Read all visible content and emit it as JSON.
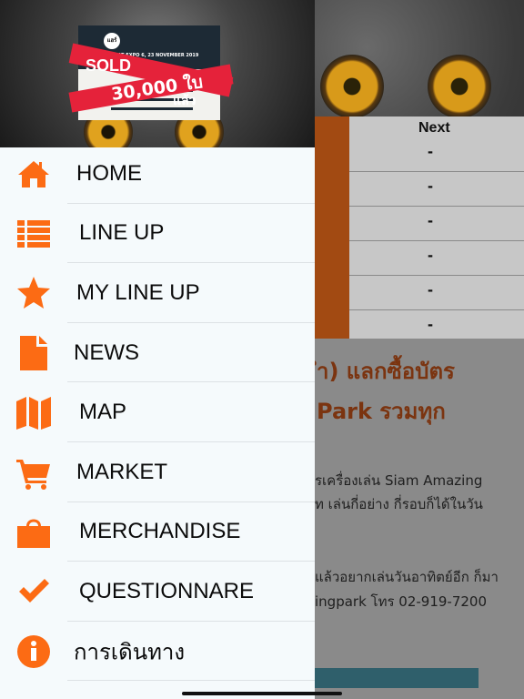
{
  "background": {
    "table": {
      "header": "Next",
      "rows": [
        "-",
        "-",
        "-",
        "-",
        "-",
        "-"
      ]
    },
    "headline_lines": [
      "ำ) แลกซื้อบัตร",
      "Park รวมทุก"
    ],
    "paragraph_lines": [
      "รเครื่องเล่น Siam Amazing",
      "ท เล่นกี่อย่าง กี่รอบก็ได้ในวัน",
      "แล้วอยากเล่นวันอาทิตย์อีก ก็มา",
      "ingpark โทร 02-919-7200"
    ]
  },
  "drawer": {
    "poster": {
      "logo": "แฮร์",
      "date": "CAT EXPO 6, 23 NOVEMBER 2019",
      "sold_text": "SOLD",
      "count_text": "30,000 ใบ",
      "laew_text": "แล้ว"
    },
    "menu": [
      {
        "label": "HOME",
        "icon": "home-icon"
      },
      {
        "label": "LINE UP",
        "icon": "list-icon"
      },
      {
        "label": "MY LINE UP",
        "icon": "star-icon"
      },
      {
        "label": "NEWS",
        "icon": "document-icon"
      },
      {
        "label": "MAP",
        "icon": "map-icon"
      },
      {
        "label": "MARKET",
        "icon": "cart-icon"
      },
      {
        "label": "MERCHANDISE",
        "icon": "shopping-bag-icon"
      },
      {
        "label": "QUESTIONNARE",
        "icon": "checkmark-icon"
      },
      {
        "label": "การเดินทาง",
        "icon": "info-icon"
      }
    ]
  },
  "colors": {
    "accent": "#fc6b14",
    "drawer_bg": "#f5fafc"
  }
}
